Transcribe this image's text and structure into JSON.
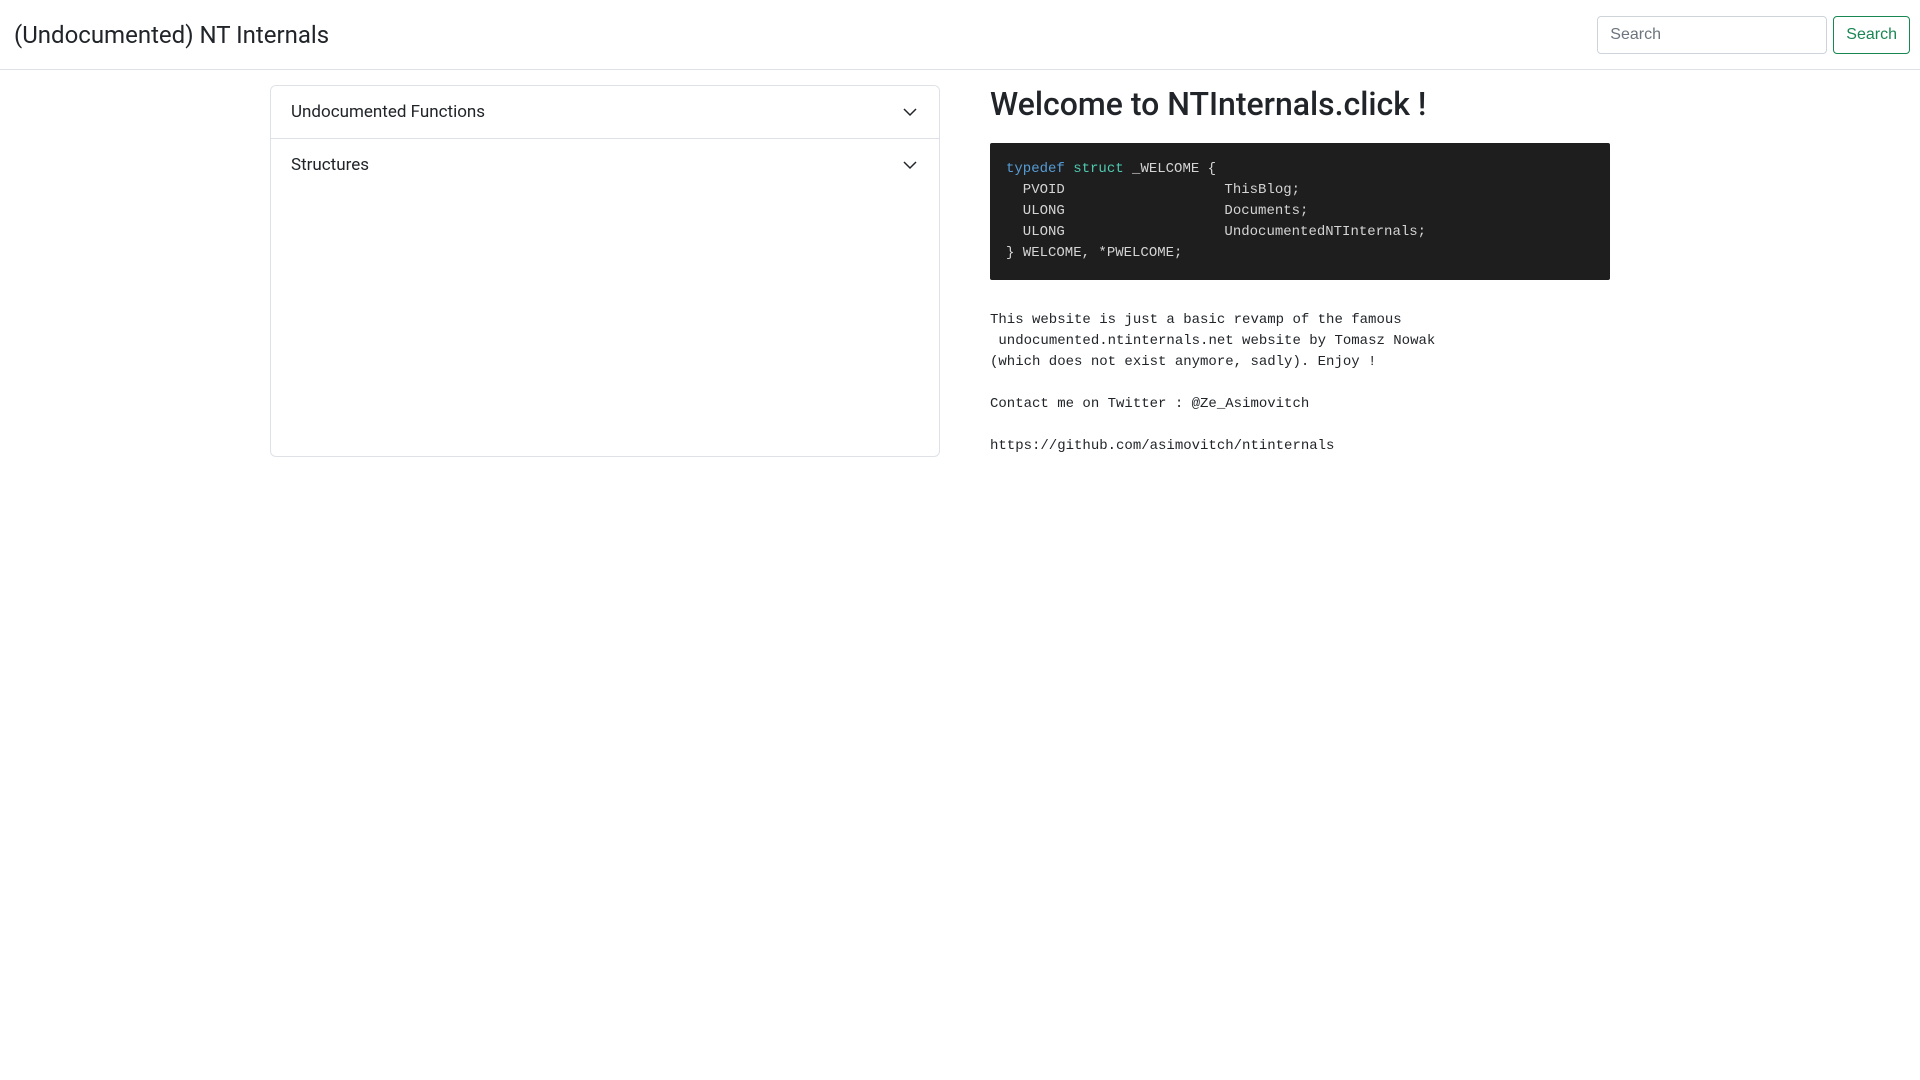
{
  "navbar": {
    "brand": "(Undocumented) NT Internals",
    "search_placeholder": "Search",
    "search_button": "Search"
  },
  "accordion": {
    "items": [
      {
        "label": "Undocumented Functions"
      },
      {
        "label": "Structures"
      }
    ]
  },
  "content": {
    "heading": "Welcome to NTInternals.click !",
    "code": {
      "kw_typedef": "typedef",
      "kw_struct": "struct",
      "rest_line0": " _WELCOME {",
      "line1": "  PVOID                   ThisBlog;",
      "line2": "  ULONG                   Documents;",
      "line3": "  ULONG                   UndocumentedNTInternals;",
      "line4": "} WELCOME, *PWELCOME;"
    },
    "description": "This website is just a basic revamp of the famous\n undocumented.ntinternals.net website by Tomasz Nowak\n(which does not exist anymore, sadly). Enjoy !\n\nContact me on Twitter : @Ze_Asimovitch\n\nhttps://github.com/asimovitch/ntinternals"
  }
}
